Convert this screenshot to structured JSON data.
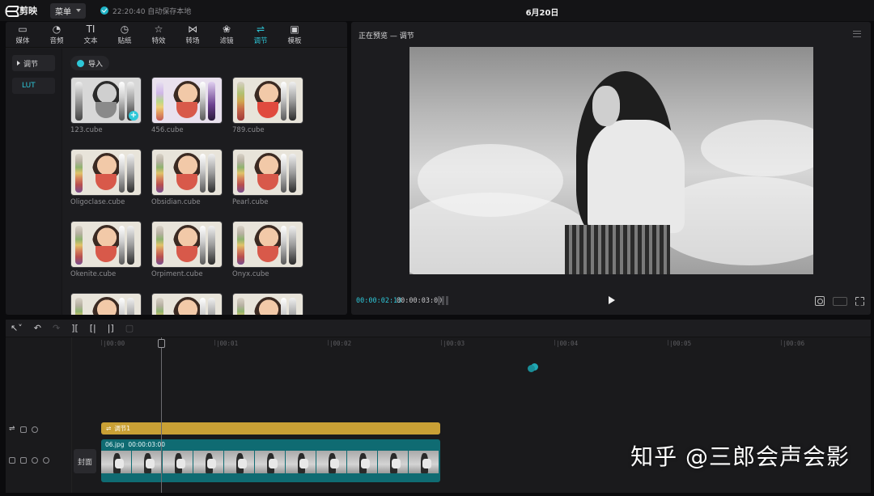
{
  "app": {
    "name": "剪映",
    "menu_label": "菜单",
    "save_status": "22:20:40 自动保存本地",
    "project_title": "6月20日"
  },
  "toolbar": {
    "tabs": [
      {
        "label": "媒体",
        "icon": "media-icon"
      },
      {
        "label": "音频",
        "icon": "audio-icon"
      },
      {
        "label": "文本",
        "icon": "text-icon"
      },
      {
        "label": "贴纸",
        "icon": "sticker-icon"
      },
      {
        "label": "特效",
        "icon": "effects-icon"
      },
      {
        "label": "转场",
        "icon": "transition-icon"
      },
      {
        "label": "滤镜",
        "icon": "filter-icon"
      },
      {
        "label": "调节",
        "icon": "adjust-icon",
        "active": true
      },
      {
        "label": "模板",
        "icon": "template-icon"
      }
    ]
  },
  "side_nav": {
    "items": [
      {
        "label": "调节"
      },
      {
        "label": "LUT"
      }
    ]
  },
  "import_label": "导入",
  "luts": [
    {
      "name": "123.cube"
    },
    {
      "name": "456.cube"
    },
    {
      "name": "789.cube"
    },
    {
      "name": "Oligoclase.cube"
    },
    {
      "name": "Obsidian.cube"
    },
    {
      "name": "Pearl.cube"
    },
    {
      "name": "Okenite.cube"
    },
    {
      "name": "Orpiment.cube"
    },
    {
      "name": "Onyx.cube"
    },
    {
      "name": ""
    },
    {
      "name": ""
    },
    {
      "name": ""
    }
  ],
  "preview": {
    "title": "正在预览 — 调节",
    "current_time": "00:00:02:13",
    "duration": "00:00:03:00"
  },
  "timeline": {
    "ruler": [
      "|00:00",
      "|00:01",
      "|00:02",
      "|00:03",
      "|00:04",
      "|00:05",
      "|00:06"
    ],
    "adjust_clip_label": "调节1",
    "video_clip": {
      "name": "06.jpg",
      "duration": "00:00:03:00"
    },
    "cover_label": "封面"
  },
  "watermark": "知乎 @三郎会声会影",
  "colors": {
    "accent": "#2ec7d8",
    "adjust_clip": "#c9a035",
    "video_clip": "#0f6b72"
  }
}
